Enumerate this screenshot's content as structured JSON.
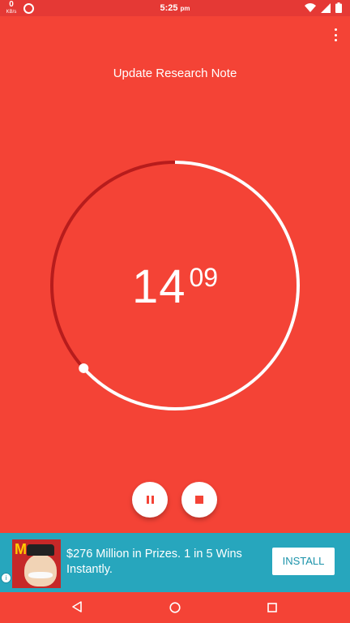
{
  "colors": {
    "background": "#f44336",
    "status_bar": "#e53935",
    "ring_elapsed": "#b71c1c",
    "ring_remaining": "#ffffff",
    "ad_background": "#27a6bd"
  },
  "status_bar": {
    "speed_value": "0",
    "speed_unit": "KB/s",
    "time": "5:25",
    "time_suffix": "pm",
    "icons": [
      "data-saver-icon",
      "wifi-icon",
      "signal-icon",
      "battery-icon"
    ]
  },
  "header": {
    "task_title": "Update Research Note",
    "menu_icon": "more-vertical-icon"
  },
  "timer": {
    "minutes": "14",
    "seconds": "09",
    "progress_elapsed_fraction": 0.367
  },
  "controls": {
    "pause_icon": "pause-icon",
    "stop_icon": "stop-icon"
  },
  "ad": {
    "brand_letter": "M",
    "text": "$276 Million in Prizes. 1 in 5 Wins Instantly.",
    "button_label": "INSTALL",
    "info_glyph": "i"
  },
  "nav": {
    "icons": [
      "back-icon",
      "home-icon",
      "recents-icon"
    ]
  }
}
